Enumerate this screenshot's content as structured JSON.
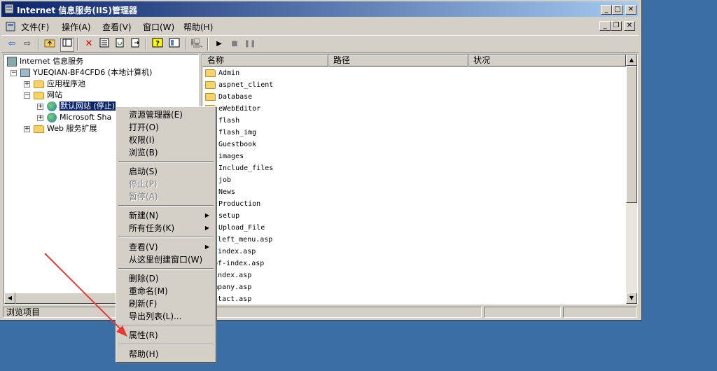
{
  "window": {
    "title": "Internet 信息服务(IIS)管理器",
    "controls": {
      "minimize": "_",
      "maximize": "□",
      "close": "✕"
    },
    "mdi_controls": {
      "minimize": "_",
      "restore": "❐",
      "close": "✕"
    }
  },
  "menubar": [
    "文件(F)",
    "操作(A)",
    "查看(V)",
    "窗口(W)",
    "帮助(H)"
  ],
  "toolbar_icons": [
    "back-icon",
    "forward-icon",
    "up-folder-icon",
    "show-tree-icon",
    "delete-icon",
    "properties-icon",
    "refresh-icon",
    "export-list-icon",
    "help-icon",
    "console-icon",
    "computer-icon",
    "play-icon",
    "stop-icon",
    "pause-icon"
  ],
  "tree": {
    "root": "Internet 信息服务",
    "computer": "YUEQIAN-BF4CFD6 (本地计算机)",
    "app_pools": "应用程序池",
    "websites": "网站",
    "default_site": "默认网站 (停止)",
    "sharepoint": "Microsoft Sha",
    "web_ext": "Web 服务扩展"
  },
  "list": {
    "columns": [
      "名称",
      "路径",
      "状况"
    ],
    "items": [
      "Admin",
      "aspnet_client",
      "Database",
      "eWebEditor",
      "flash",
      "flash_img",
      "Guestbook",
      "images",
      "Include_files",
      "job",
      "News",
      "Production",
      "setup",
      "Upload_File",
      "bf-left_menu.asp",
      "bflindex.asp",
      "bfbf-index.asp",
      "bfindex.asp",
      "company.asp",
      "contact.asp"
    ]
  },
  "status": {
    "text": "浏览项目"
  },
  "context_menu": {
    "items": [
      {
        "label": "资源管理器(E)",
        "disabled": false
      },
      {
        "label": "打开(O)",
        "disabled": false
      },
      {
        "label": "权限(I)",
        "disabled": false
      },
      {
        "label": "浏览(B)",
        "disabled": false
      },
      {
        "label": "启动(S)",
        "disabled": false
      },
      {
        "label": "停止(P)",
        "disabled": true
      },
      {
        "label": "暂停(A)",
        "disabled": true
      },
      {
        "label": "新建(N)",
        "disabled": false,
        "submenu": true
      },
      {
        "label": "所有任务(K)",
        "disabled": false,
        "submenu": true
      },
      {
        "label": "查看(V)",
        "disabled": false,
        "submenu": true
      },
      {
        "label": "从这里创建窗口(W)",
        "disabled": false
      },
      {
        "label": "删除(D)",
        "disabled": false
      },
      {
        "label": "重命名(M)",
        "disabled": false
      },
      {
        "label": "刷新(F)",
        "disabled": false
      },
      {
        "label": "导出列表(L)...",
        "disabled": false
      },
      {
        "label": "属性(R)",
        "disabled": false
      },
      {
        "label": "帮助(H)",
        "disabled": false
      }
    ]
  },
  "colors": {
    "titlebar": "#0a246a",
    "desktop": "#3a6ea5",
    "selection": "#0a246a",
    "arrow": "#e53935"
  }
}
